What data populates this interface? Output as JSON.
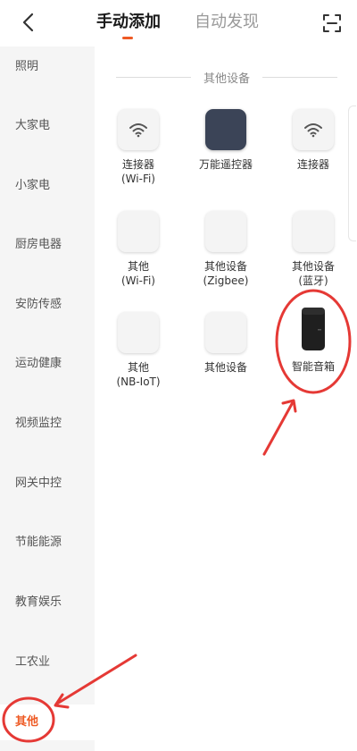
{
  "header": {
    "tabs": [
      {
        "label": "手动添加",
        "active": true
      },
      {
        "label": "自动发现",
        "active": false
      }
    ],
    "back_icon": "chevron-left-icon",
    "scan_icon": "scan-icon"
  },
  "sidebar": {
    "items": [
      {
        "label": "照明"
      },
      {
        "label": "大家电"
      },
      {
        "label": "小家电"
      },
      {
        "label": "厨房电器"
      },
      {
        "label": "安防传感"
      },
      {
        "label": "运动健康"
      },
      {
        "label": "视频监控"
      },
      {
        "label": "网关中控"
      },
      {
        "label": "节能能源"
      },
      {
        "label": "教育娱乐"
      },
      {
        "label": "工农业"
      },
      {
        "label": "其他",
        "active": true
      }
    ]
  },
  "main": {
    "section_title": "其他设备",
    "devices": [
      {
        "name": "连接器\n(Wi-Fi)",
        "icon": "wifi-icon"
      },
      {
        "name": "万能遥控器",
        "icon": "remote-icon"
      },
      {
        "name": "连接器",
        "icon": "wifi-icon"
      },
      {
        "name": "其他\n(Wi-Fi)",
        "icon": "blank-tile"
      },
      {
        "name": "其他设备\n(Zigbee)",
        "icon": "blank-tile"
      },
      {
        "name": "其他设备\n(蓝牙)",
        "icon": "blank-tile"
      },
      {
        "name": "其他\n(NB-IoT)",
        "icon": "blank-tile"
      },
      {
        "name": "其他设备",
        "icon": "blank-tile"
      },
      {
        "name": "智能音箱",
        "icon": "smart-speaker-icon"
      }
    ]
  },
  "colors": {
    "accent": "#ee5a24",
    "annotation_red": "#e53935",
    "sidebar_bg": "#f5f5f5",
    "remote_tile": "#3b4457"
  }
}
